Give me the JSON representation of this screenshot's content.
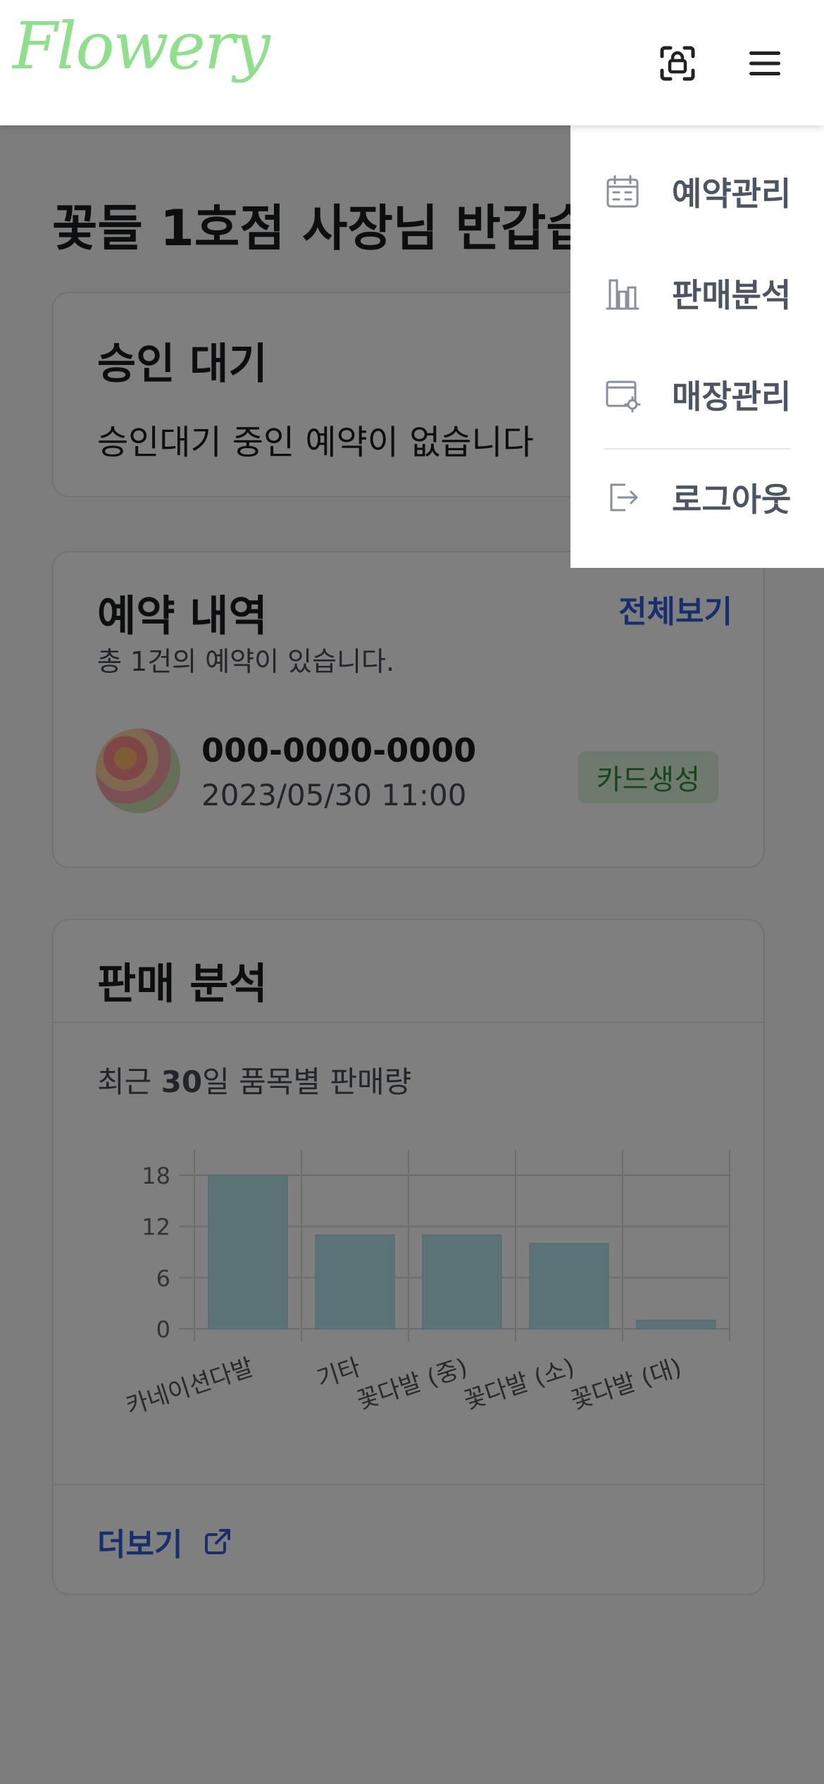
{
  "header": {
    "logo": "Flowery",
    "scan_icon": "scan-icon",
    "menu_icon": "hamburger-menu-icon"
  },
  "greeting": "꽃들 1호점 사장님 반갑습",
  "approval": {
    "title": "승인 대기",
    "empty_text": "승인대기 중인 예약이 없습니다"
  },
  "reservations": {
    "title": "예약 내역",
    "view_all": "전체보기",
    "count_text": "총 1건의 예약이 있습니다.",
    "items": [
      {
        "phone": "000-0000-0000",
        "datetime": "2023/05/30 11:00",
        "status": "카드생성"
      }
    ]
  },
  "sales": {
    "title": "판매 분석",
    "subtitle_pre": "최근 ",
    "subtitle_bold": "30",
    "subtitle_post": "일 품목별 판매량",
    "more": "더보기"
  },
  "chart_data": {
    "type": "bar",
    "categories": [
      "카네이션다발",
      "기타",
      "꽃다발 (중)",
      "꽃다발 (소)",
      "꽃다발 (대)"
    ],
    "values": [
      18,
      11,
      11,
      10,
      1
    ],
    "yticks": [
      0,
      6,
      12,
      18
    ],
    "ylim": [
      0,
      18
    ],
    "grid": true,
    "bar_color": "#b8e6f0"
  },
  "menu": {
    "items": [
      {
        "label": "예약관리",
        "icon": "calendar-icon"
      },
      {
        "label": "판매분석",
        "icon": "bar-chart-icon"
      },
      {
        "label": "매장관리",
        "icon": "store-settings-icon"
      },
      {
        "label": "로그아웃",
        "icon": "logout-icon"
      }
    ]
  },
  "colors": {
    "logo": "#8fe08d",
    "link": "#2f5ed8",
    "badge_bg": "#dff5dc",
    "badge_text": "#2e8a3a",
    "overlay": "rgba(0,0,0,0.5)"
  }
}
